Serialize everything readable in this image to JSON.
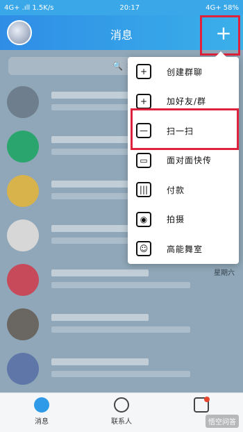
{
  "status": {
    "left_text": "4G+ .ıll 1.5K/s",
    "time": "20:17",
    "right_text": "4G+ 58%"
  },
  "header": {
    "title": "消息",
    "plus_icon": "plus-icon"
  },
  "search": {
    "placeholder": "搜"
  },
  "list": {
    "items": [
      {
        "snippet": "",
        "date": "",
        "avatar_color": "#6e7e8c"
      },
      {
        "snippet": "",
        "date": "",
        "avatar_color": "#2aa56e"
      },
      {
        "snippet": "",
        "date": "",
        "avatar_color": "#d8b24a"
      },
      {
        "snippet": "",
        "date": "",
        "avatar_color": "#d7d7d7"
      },
      {
        "snippet": "",
        "date": "星期六",
        "avatar_color": "#c64a5a"
      },
      {
        "snippet": "",
        "date": "",
        "avatar_color": "#6a6762"
      },
      {
        "snippet": "",
        "date": "",
        "avatar_color": "#5e77a8"
      }
    ]
  },
  "menu": {
    "items": [
      {
        "label": "创建群聊",
        "icon": "create-group-icon"
      },
      {
        "label": "加好友/群",
        "icon": "add-friend-icon"
      },
      {
        "label": "扫一扫",
        "icon": "scan-icon"
      },
      {
        "label": "面对面快传",
        "icon": "face-to-face-icon"
      },
      {
        "label": "付款",
        "icon": "barcode-icon"
      },
      {
        "label": "拍摄",
        "icon": "camera-icon"
      },
      {
        "label": "高能舞室",
        "icon": "dance-icon"
      }
    ]
  },
  "bottom_nav": {
    "items": [
      {
        "label": "消息",
        "icon": "message-icon"
      },
      {
        "label": "联系人",
        "icon": "contacts-icon"
      },
      {
        "label": "",
        "icon": "star-icon"
      }
    ],
    "watermark": "悟空问答"
  }
}
